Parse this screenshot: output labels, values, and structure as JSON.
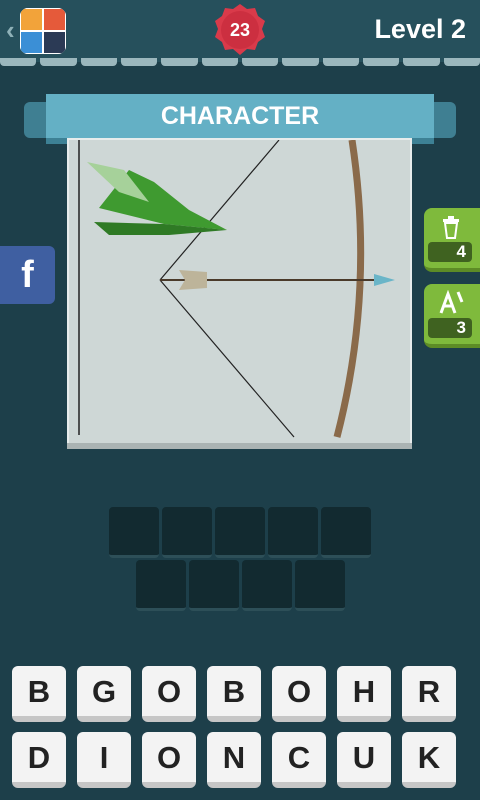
{
  "header": {
    "back_glyph": "‹",
    "coins": "23",
    "level_label": "Level 2",
    "coin_color": "#d93a4a"
  },
  "category": "CHARACTER",
  "hints": [
    {
      "icon": "trash-can-icon",
      "count": "4"
    },
    {
      "icon": "reveal-letter-icon",
      "count": "3"
    }
  ],
  "facebook_label": "f",
  "answer": {
    "row1_slots": 5,
    "row2_slots": 4
  },
  "keyboard": {
    "row1": [
      "B",
      "G",
      "O",
      "B",
      "O",
      "H",
      "R"
    ],
    "row2": [
      "D",
      "I",
      "O",
      "N",
      "C",
      "U",
      "K"
    ]
  }
}
